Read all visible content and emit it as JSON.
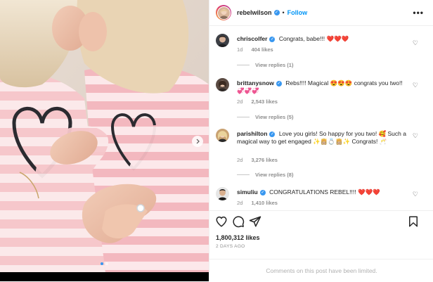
{
  "post": {
    "author": "rebelwilson",
    "follow_label": "Follow",
    "separator": "•",
    "more_icon": "more-horizontal-icon",
    "media": {
      "slides_total": 2,
      "current_slide": 1,
      "next_icon": "chevron-right-icon"
    }
  },
  "comments": [
    {
      "username": "chriscolfer",
      "verified": true,
      "text": "Congrats, babe!!!",
      "emoji": "❤️❤️❤️",
      "time": "1d",
      "likes": "404 likes",
      "replies": "View replies (1)"
    },
    {
      "username": "brittanysnow",
      "verified": true,
      "text": "Rebs!!!! Magical 😍😍😍 congrats you two!! 💞💞💞",
      "emoji": "",
      "time": "2d",
      "likes": "2,543 likes",
      "replies": "View replies (5)"
    },
    {
      "username": "parishilton",
      "verified": true,
      "text": "Love you girls! So happy for you two! 🥰 Such a magical way to get engaged ✨👸🏼💍👸🏼✨ Congrats! 🥂",
      "emoji": "",
      "time": "2d",
      "likes": "3,276 likes",
      "replies": "View replies (8)"
    },
    {
      "username": "simuliu",
      "verified": true,
      "text": "CONGRATULATIONS REBEL!!!!",
      "emoji": "❤️❤️❤️",
      "time": "2d",
      "likes": "1,410 likes",
      "replies": ""
    }
  ],
  "actions": {
    "like_icon": "heart-icon",
    "comment_icon": "comment-icon",
    "share_icon": "paper-plane-icon",
    "save_icon": "bookmark-icon"
  },
  "likes_total": "1,800,312 likes",
  "date": "2 DAYS AGO",
  "comments_limited": "Comments on this post have been limited.",
  "colors": {
    "accent": "#0095f6",
    "verified": "#3897f0",
    "heart_red": "#ed1b3c",
    "muted": "#8e8e8e"
  }
}
